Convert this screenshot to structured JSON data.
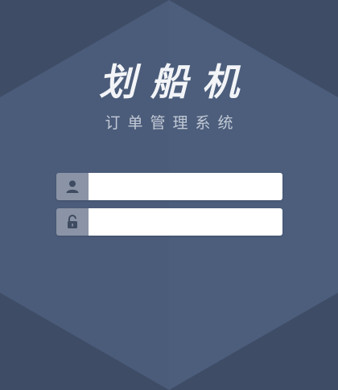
{
  "brand": {
    "title": "划船机",
    "subtitle": "订单管理系统"
  },
  "login": {
    "username": {
      "icon": "user-icon",
      "value": "",
      "placeholder": ""
    },
    "password": {
      "icon": "unlock-icon",
      "value": "",
      "placeholder": ""
    }
  },
  "colors": {
    "background": "#3e4c66",
    "hexagon": "#4d5f7d",
    "icon_box": "#8a94a6",
    "title": "#f2f4f7",
    "subtitle": "#c3cad6"
  }
}
